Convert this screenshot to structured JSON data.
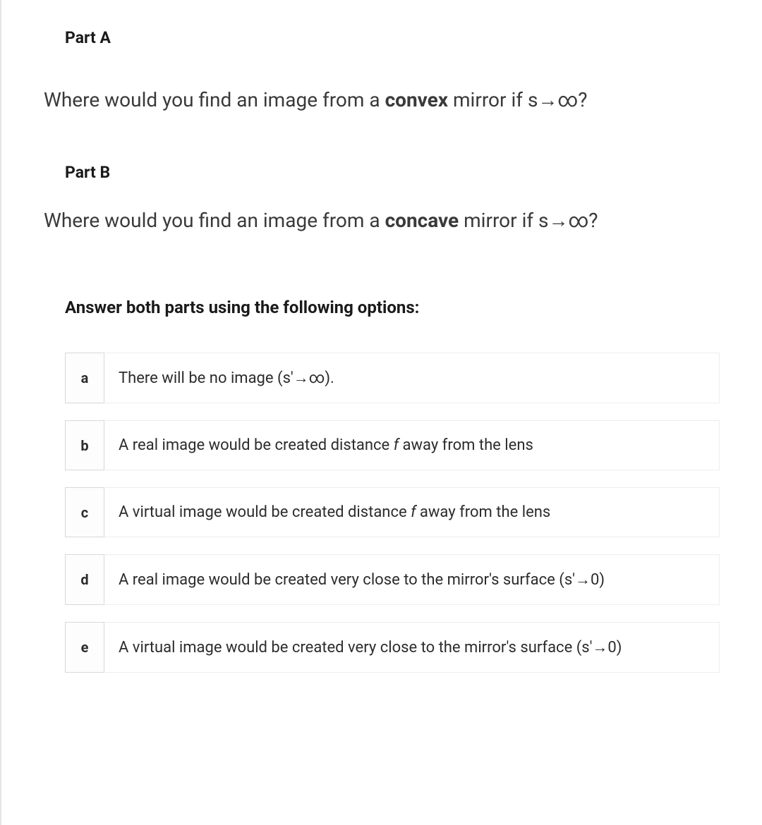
{
  "partA": {
    "label": "Part A",
    "question_pre": "Where would you find an image from a ",
    "question_bold": "convex",
    "question_post": " mirror if s→∞?"
  },
  "partB": {
    "label": "Part B",
    "question_pre": "Where would you find an image from a ",
    "question_bold": "concave",
    "question_post": " mirror if s→∞?"
  },
  "instruction": "Answer both parts using the following options:",
  "options": [
    {
      "letter": "a",
      "text_pre": "There will be no image (s'→∞).",
      "text_italic": "",
      "text_post": ""
    },
    {
      "letter": "b",
      "text_pre": "A  real image would be created distance ",
      "text_italic": "f ",
      "text_post": "away from the lens"
    },
    {
      "letter": "c",
      "text_pre": "A virtual image would be created distance ",
      "text_italic": "f ",
      "text_post": "away from the lens"
    },
    {
      "letter": "d",
      "text_pre": "A real image would be created very close to the mirror's surface (s'→0)",
      "text_italic": "",
      "text_post": ""
    },
    {
      "letter": "e",
      "text_pre": "A virtual image would be created very close to the mirror's surface (s'→0)",
      "text_italic": "",
      "text_post": ""
    }
  ]
}
